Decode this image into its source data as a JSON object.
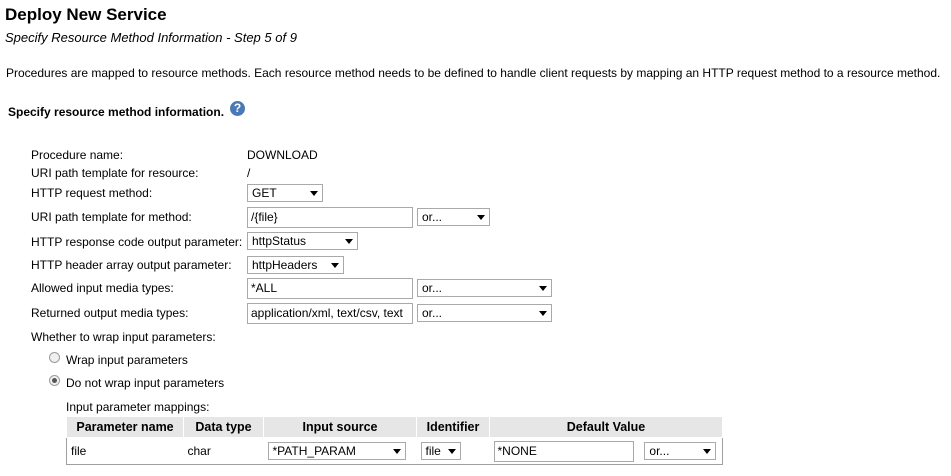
{
  "header": {
    "title": "Deploy New Service",
    "subtitle": "Specify Resource Method Information - Step 5 of 9"
  },
  "intro": "Procedures are mapped to resource methods. Each resource method needs to be defined to handle client requests by mapping an HTTP request method to a resource method.",
  "section": {
    "title": "Specify resource method information.",
    "help_icon": "?"
  },
  "form": {
    "procedure_name_label": "Procedure name:",
    "procedure_name": "DOWNLOAD",
    "uri_resource_label": "URI path template for resource:",
    "uri_resource": "/",
    "http_method_label": "HTTP request method:",
    "http_method": "GET",
    "uri_method_label": "URI path template for method:",
    "uri_method": "/{file}",
    "uri_method_or": "or...",
    "response_code_label": "HTTP response code output parameter:",
    "response_code": "httpStatus",
    "header_array_label": "HTTP header array output parameter:",
    "header_array": "httpHeaders",
    "input_media_label": "Allowed input media types:",
    "input_media": "*ALL",
    "input_media_or": "or...",
    "output_media_label": "Returned output media types:",
    "output_media": "application/xml, text/csv, text",
    "output_media_or": "or...",
    "wrap_label": "Whether to wrap input parameters:",
    "wrap_option": "Wrap input parameters",
    "no_wrap_option": "Do not wrap input parameters",
    "wrap_selected": "no_wrap"
  },
  "mappings": {
    "label": "Input parameter mappings:",
    "headers": [
      "Parameter name",
      "Data type",
      "Input source",
      "Identifier",
      "Default Value"
    ],
    "rows": [
      {
        "name": "file",
        "type": "char",
        "source": "*PATH_PARAM",
        "identifier": "file",
        "default": "*NONE",
        "default_or": "or..."
      }
    ]
  },
  "colors": {
    "help_icon_bg": "#4a79b7",
    "table_header_bg": "#e6e6e6"
  }
}
